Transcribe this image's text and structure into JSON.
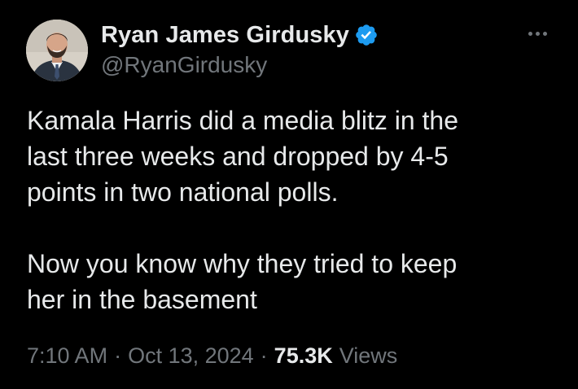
{
  "tweet": {
    "author": {
      "display_name": "Ryan James Girdusky",
      "handle": "@RyanGirdusky",
      "verified_icon": "verified-badge-icon",
      "avatar": "profile-photo"
    },
    "menu_icon": "more-options-icon",
    "text": {
      "paragraph1_line1": "Kamala Harris did a media blitz in the",
      "paragraph1_line2": "last three weeks and dropped by 4-5",
      "paragraph1_line3": "points in two national polls.",
      "paragraph2_line1": "Now you know why they tried to keep",
      "paragraph2_line2": "her in the basement"
    },
    "meta": {
      "time": "7:10 AM",
      "separator": "·",
      "date": "Oct 13, 2024",
      "views_count": "75.3K",
      "views_label": "Views"
    }
  },
  "colors": {
    "background": "#000000",
    "text_primary": "#e7e9ea",
    "text_secondary": "#71767b",
    "verified_blue": "#1d9bf0"
  }
}
